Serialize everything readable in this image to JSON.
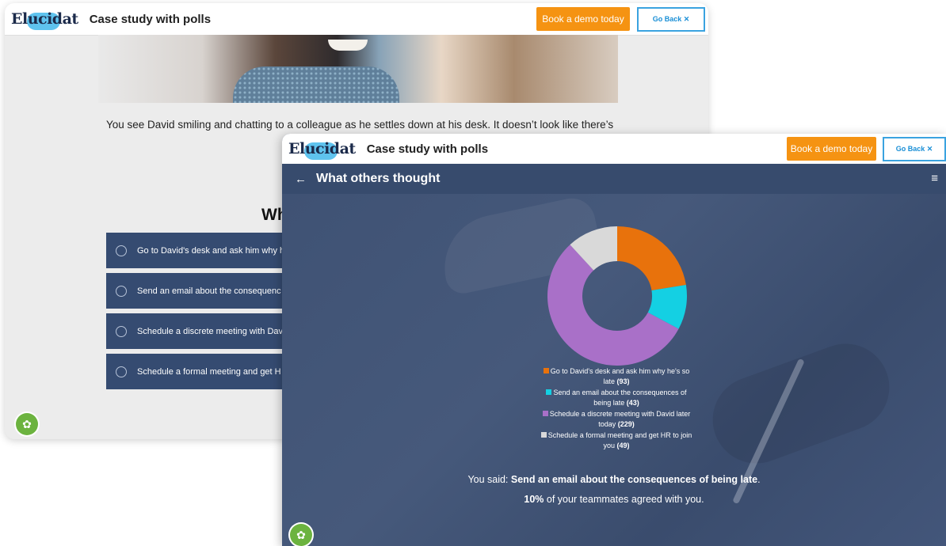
{
  "back_window": {
    "brand": "Elucidat",
    "title": "Case study with polls",
    "demo_button": "Book a demo today",
    "back_button": "Go Back ✕",
    "body_text": "You see David smiling and chatting to a colleague as he settles down at his desk. It doesn’t look like there’s",
    "question_heading": "Wh",
    "options": [
      "Go to David's desk and ask him why h",
      "Send an email about the consequenc",
      "Schedule a discrete meeting with Dav",
      "Schedule a formal meeting and get H"
    ]
  },
  "front_window": {
    "brand": "Elucidat",
    "title": "Case study with polls",
    "demo_button": "Book a demo today",
    "back_button": "Go Back ✕",
    "back_arrow": "←",
    "page_title": "What others thought",
    "menu_icon": "≡",
    "said_prefix": "You said: ",
    "said_answer": "Send an email about the consequences of being late",
    "said_suffix": ".",
    "agree_percent": "10%",
    "agree_text": " of your teammates agreed with you."
  },
  "chart_data": {
    "type": "pie",
    "donut": true,
    "categories": [
      "Go to David's desk and ask him why he's so late",
      "Send an email about the consequences of being late",
      "Schedule a discrete meeting with David later today",
      "Schedule a formal meeting and get HR to join you"
    ],
    "values": [
      93,
      43,
      229,
      49
    ],
    "value_labels": [
      "(93)",
      "(43)",
      "(229)",
      "(49)"
    ],
    "colors": [
      "#e8720c",
      "#14d0e3",
      "#a970c8",
      "#d9d9d9"
    ],
    "legend_placement": "bottom"
  },
  "icons": {
    "cookie": "cookie-icon",
    "close": "close-icon",
    "back": "back-arrow-icon",
    "menu": "hamburger-menu-icon"
  }
}
